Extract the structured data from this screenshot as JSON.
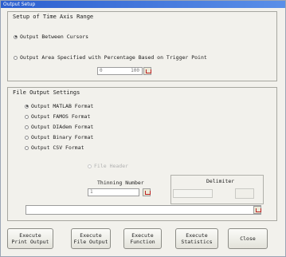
{
  "window": {
    "title": "Output Setup"
  },
  "time_axis": {
    "title": "Setup of Time Axis Range",
    "option_cursors": "Output Between Cursors",
    "option_trigger": "Output Area Specified with Percentage Based on Trigger Point",
    "percent_left": "0",
    "percent_right": "100",
    "selected": "cursors"
  },
  "file_output": {
    "title": "File Output Settings",
    "formats": [
      "Output MATLAB Format",
      "Output FAMOS Format",
      "Output DIAdem Format",
      "Output Binary Format",
      "Output CSV Format"
    ],
    "selected_index": 0,
    "disabled_option": "File Header",
    "thinning_label": "Thinning Number",
    "thinning_value": "1",
    "delimiter_label": "Delimiter",
    "path_value": ""
  },
  "buttons": {
    "print": [
      "Execute",
      "Print Output"
    ],
    "file": [
      "Execute",
      "File Output"
    ],
    "function": [
      "Execute",
      "Function"
    ],
    "statistics": [
      "Execute",
      "Statistics"
    ],
    "close": "Close"
  },
  "colors": {
    "title_bar": "#2c5fcf",
    "panel": "#f2f1ec",
    "icon_red": "#b22222"
  }
}
